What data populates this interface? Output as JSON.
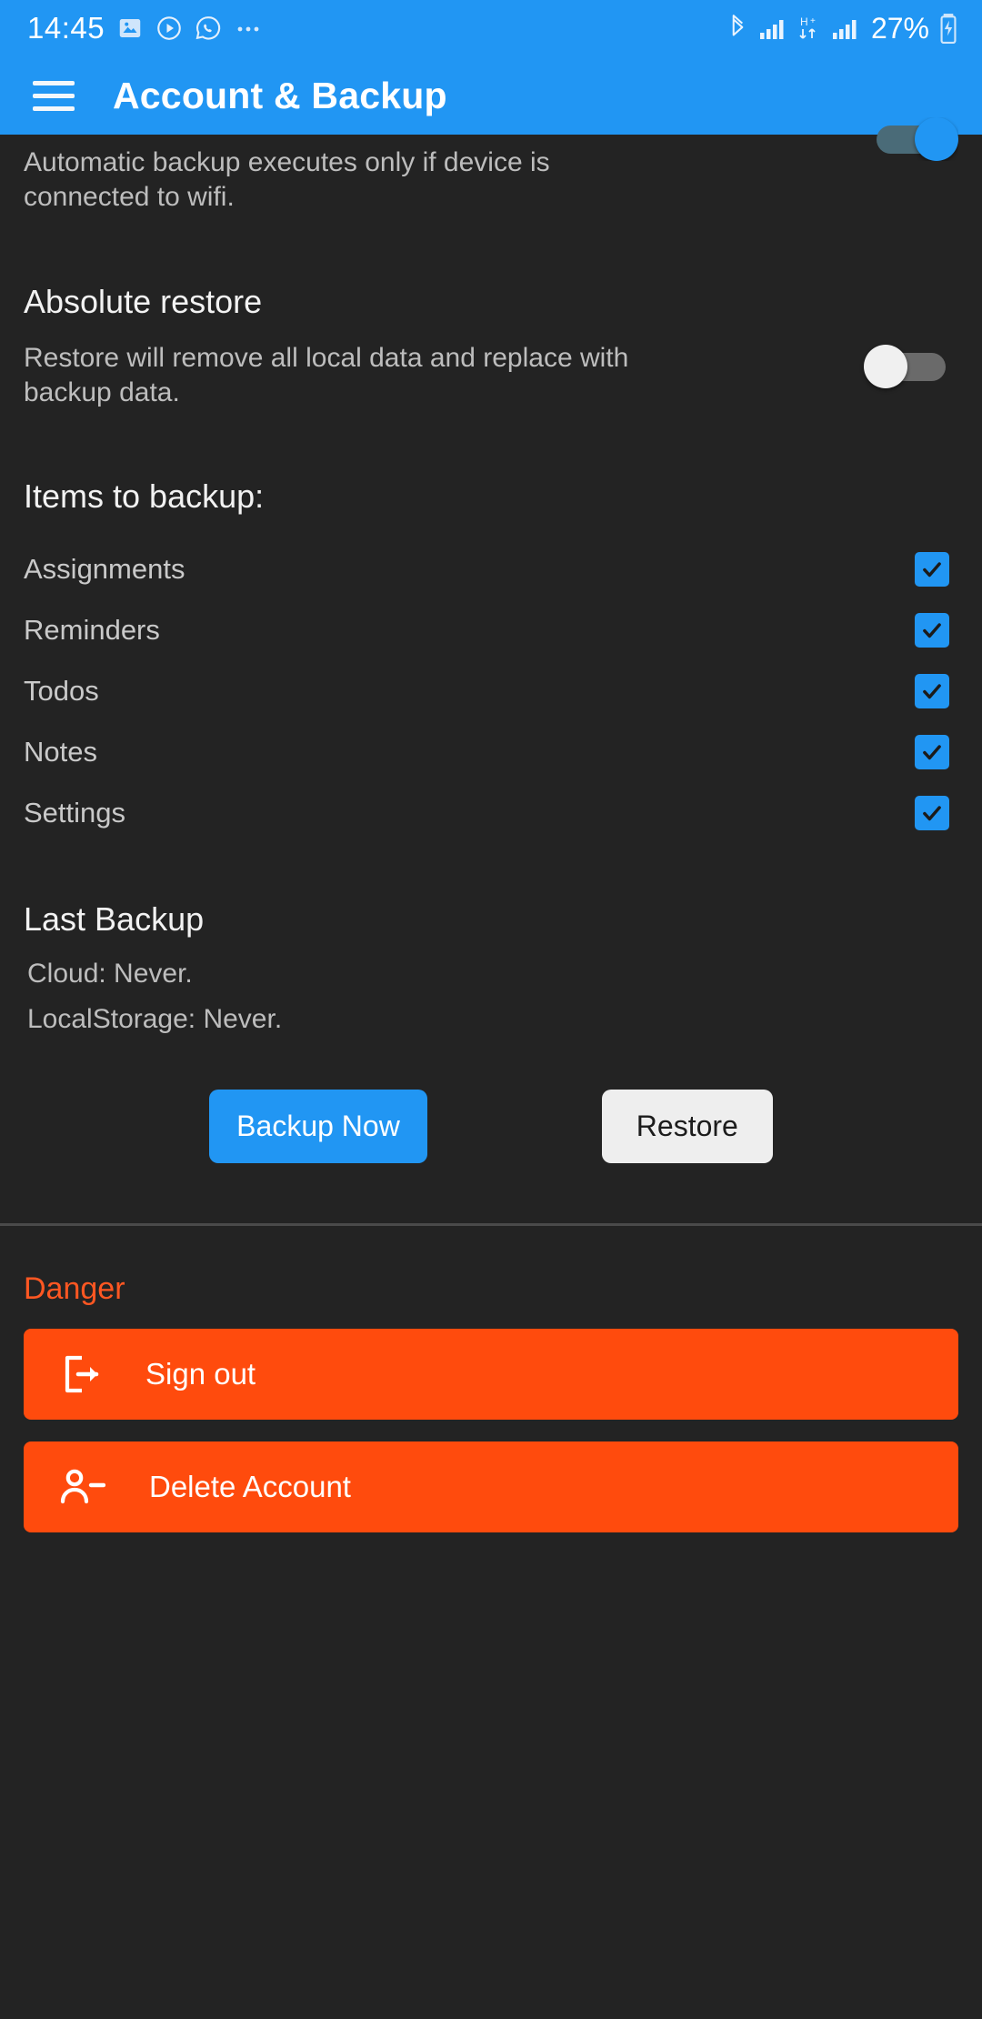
{
  "statusbar": {
    "clock": "14:45",
    "icons": [
      "image-icon",
      "play-circle-icon",
      "whatsapp-icon",
      "more-dots-icon"
    ],
    "right_icons": [
      "bluetooth-icon",
      "signal-bars-icon",
      "hplus-data-icon",
      "signal-bars-icon"
    ],
    "battery_percent": "27%",
    "battery_icon": "battery-charging-icon",
    "accent": "#2196F3"
  },
  "appbar": {
    "menu_icon": "hamburger-menu-icon",
    "title": "Account & Backup",
    "background": "#2196F3"
  },
  "wifi_only": {
    "description": "Automatic backup executes only if device is connected to wifi.",
    "toggle_state": "on"
  },
  "absolute_restore": {
    "title": "Absolute restore",
    "description": "Restore will remove all local data and replace with backup data.",
    "toggle_state": "off"
  },
  "items_to_backup": {
    "heading": "Items to backup:",
    "items": [
      {
        "label": "Assignments",
        "checked": true
      },
      {
        "label": "Reminders",
        "checked": true
      },
      {
        "label": "Todos",
        "checked": true
      },
      {
        "label": "Notes",
        "checked": true
      },
      {
        "label": "Settings",
        "checked": true
      }
    ],
    "checkbox_color": "#2196F3"
  },
  "last_backup": {
    "heading": "Last Backup",
    "cloud": "Cloud: Never.",
    "local": "LocalStorage: Never."
  },
  "actions": {
    "backup_now": "Backup Now",
    "restore": "Restore",
    "primary_color": "#2196F3",
    "light_color": "#eeeeee"
  },
  "danger": {
    "label": "Danger",
    "label_color": "#FF5722",
    "button_color": "#FF4B0D",
    "sign_out": {
      "label": "Sign out",
      "icon": "sign-out-icon"
    },
    "delete_account": {
      "label": "Delete Account",
      "icon": "person-remove-icon"
    }
  }
}
